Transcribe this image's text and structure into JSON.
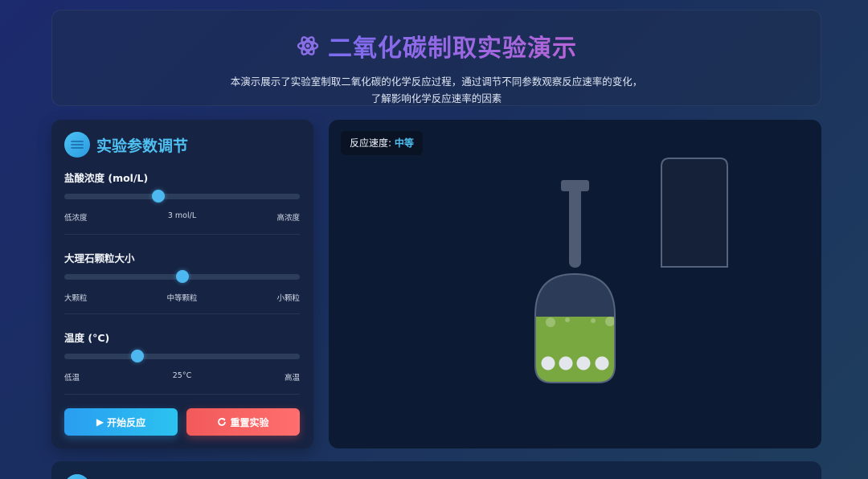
{
  "header": {
    "title": "二氧化碳制取实验演示",
    "description_line1": "本演示展示了实验室制取二氧化碳的化学反应过程，通过调节不同参数观察反应速率的变化，",
    "description_line2": "了解影响化学反应速率的因素"
  },
  "panel": {
    "title": "实验参数调节",
    "params": [
      {
        "label": "盐酸浓度 (mol/L)",
        "min_label": "低浓度",
        "value_label": "3 mol/L",
        "max_label": "高浓度",
        "level": 0.4
      },
      {
        "label": "大理石颗粒大小",
        "min_label": "大颗粒",
        "value_label": "中等颗粒",
        "max_label": "小颗粒",
        "level": 0.5
      },
      {
        "label": "温度 (°C)",
        "min_label": "低温",
        "value_label": "25°C",
        "max_label": "高温",
        "level": 0.31
      }
    ],
    "start_label": "开始反应",
    "reset_label": "重置实验"
  },
  "stage": {
    "speed_label": "反应速度: ",
    "speed_value": "中等"
  },
  "colors": {
    "accent": "#4fc0f2",
    "start": "#2a9df0",
    "reset": "#f25a5a",
    "liquid": "#7aa840"
  }
}
